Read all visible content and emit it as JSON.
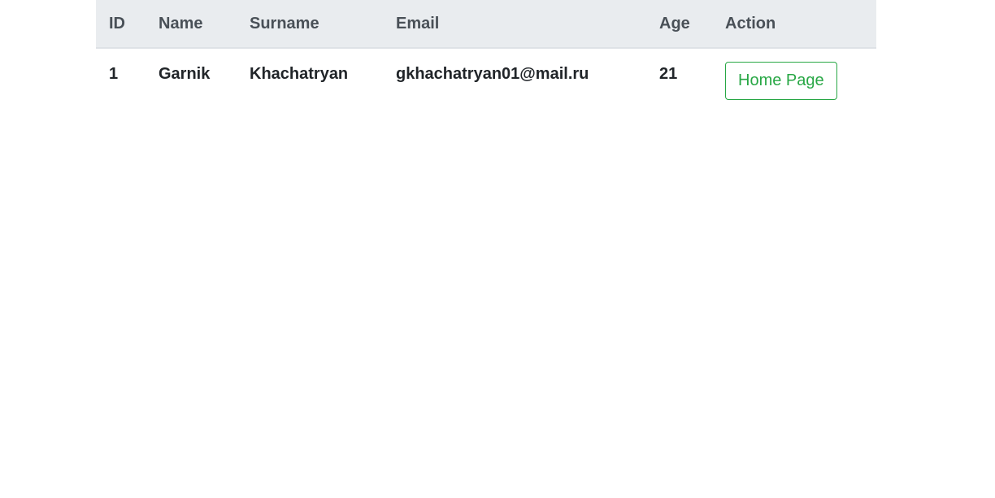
{
  "table": {
    "headers": [
      "ID",
      "Name",
      "Surname",
      "Email",
      "Age",
      "Action"
    ],
    "rows": [
      {
        "id": "1",
        "name": "Garnik",
        "surname": "Khachatryan",
        "email": "gkhachatryan01@mail.ru",
        "age": "21",
        "action_label": "Home Page"
      }
    ]
  },
  "colors": {
    "header_bg": "#e9ecef",
    "success": "#28a745"
  }
}
